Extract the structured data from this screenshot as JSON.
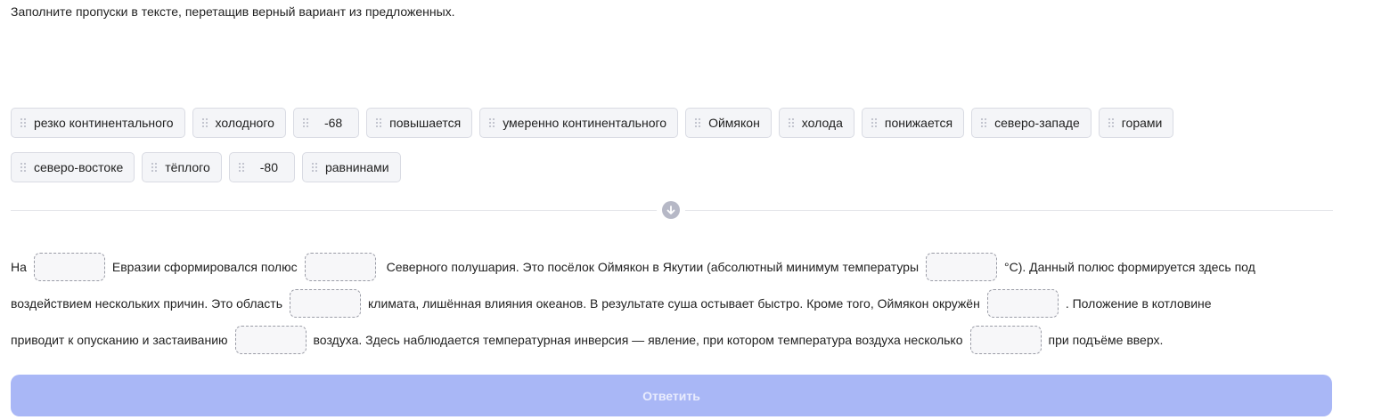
{
  "instruction": "Заполните пропуски в тексте, перетащив верный вариант из предложенных.",
  "options_row1": [
    "резко континентального",
    "холодного",
    "-68",
    "повышается",
    "умеренно континентального",
    "Оймякон",
    "холода",
    "понижается",
    "северо-западе",
    "горами"
  ],
  "options_row2": [
    "северо-востоке",
    "тёплого",
    "-80",
    "равнинами"
  ],
  "text": {
    "l1a": "На",
    "l1b": "Евразии сформировался полюс",
    "l1c": "Северного полушария. Это посёлок Оймякон в Якутии (абсолютный минимум температуры",
    "l1d": "°С). Данный полюс формируется здесь под",
    "l2a": "воздействием нескольких причин. Это область",
    "l2b": "климата, лишённая влияния океанов. В результате суша остывает быстро. Кроме того, Оймякон окружён",
    "l2c": ". Положение в котловине",
    "l3a": "приводит к опусканию и застаиванию",
    "l3b": "воздуха. Здесь наблюдается температурная инверсия — явление, при котором температура воздуха несколько",
    "l3c": "при подъёме вверх."
  },
  "submit_label": "Ответить",
  "colors": {
    "accent_disabled": "#a9b7f6",
    "chip_bg": "#f4f5f8"
  }
}
